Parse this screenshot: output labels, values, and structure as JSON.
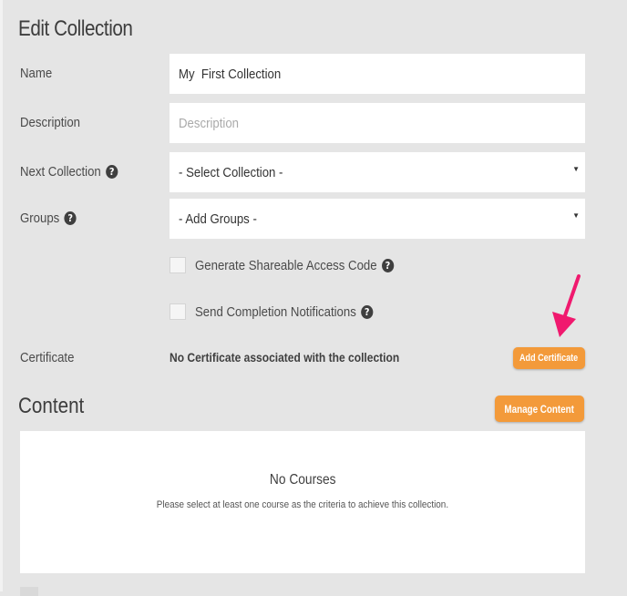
{
  "page": {
    "title": "Edit Collection"
  },
  "form": {
    "name": {
      "label": "Name",
      "value": "My  First Collection"
    },
    "description": {
      "label": "Description",
      "placeholder": "Description"
    },
    "next_collection": {
      "label": "Next Collection",
      "selected": "- Select Collection -"
    },
    "groups": {
      "label": "Groups",
      "selected": "- Add Groups -"
    },
    "shareable_code": {
      "label": "Generate Shareable Access Code",
      "checked": false
    },
    "notifications": {
      "label": "Send Completion Notifications",
      "checked": false
    },
    "certificate": {
      "label": "Certificate",
      "status_text": "No Certificate associated with the collection",
      "button_label": "Add Certificate"
    }
  },
  "content": {
    "title": "Content",
    "manage_button_label": "Manage Content",
    "empty_title": "No Courses",
    "empty_message": "Please select at least one course as the criteria to achieve this collection."
  },
  "icons": {
    "help": "question-circle-icon",
    "dropdown": "caret-down-icon",
    "annotation": "pink-arrow"
  },
  "colors": {
    "background": "#e5e5e5",
    "accent_button": "#f39a3a",
    "annotation_arrow": "#f0196e"
  }
}
